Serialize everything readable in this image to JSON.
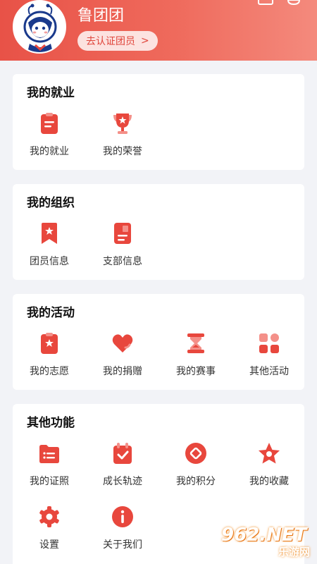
{
  "header": {
    "user_name": "鲁团团",
    "cert_label": "去认证团员",
    "cert_chevron": ">"
  },
  "sections": [
    {
      "title": "我的就业",
      "items": [
        {
          "label": "我的就业",
          "icon": "clipboard-icon"
        },
        {
          "label": "我的荣誉",
          "icon": "trophy-icon"
        }
      ]
    },
    {
      "title": "我的组织",
      "items": [
        {
          "label": "团员信息",
          "icon": "bookmark-star-icon"
        },
        {
          "label": "支部信息",
          "icon": "document-icon"
        }
      ]
    },
    {
      "title": "我的活动",
      "items": [
        {
          "label": "我的志愿",
          "icon": "star-clipboard-icon"
        },
        {
          "label": "我的捐赠",
          "icon": "heart-icon"
        },
        {
          "label": "我的赛事",
          "icon": "hourglass-icon"
        },
        {
          "label": "其他活动",
          "icon": "grid-icon"
        }
      ]
    },
    {
      "title": "其他功能",
      "items": [
        {
          "label": "我的证照",
          "icon": "folder-icon"
        },
        {
          "label": "成长轨迹",
          "icon": "calendar-check-icon"
        },
        {
          "label": "我的积分",
          "icon": "coin-icon"
        },
        {
          "label": "我的收藏",
          "icon": "star-icon"
        },
        {
          "label": "设置",
          "icon": "gear-icon"
        },
        {
          "label": "关于我们",
          "icon": "info-icon"
        }
      ]
    }
  ],
  "watermark": {
    "main": "962.NET",
    "sub": "乐游网"
  },
  "colors": {
    "accent": "#e8473d",
    "accent_light": "#f49089",
    "bg": "#f2f3f7"
  }
}
